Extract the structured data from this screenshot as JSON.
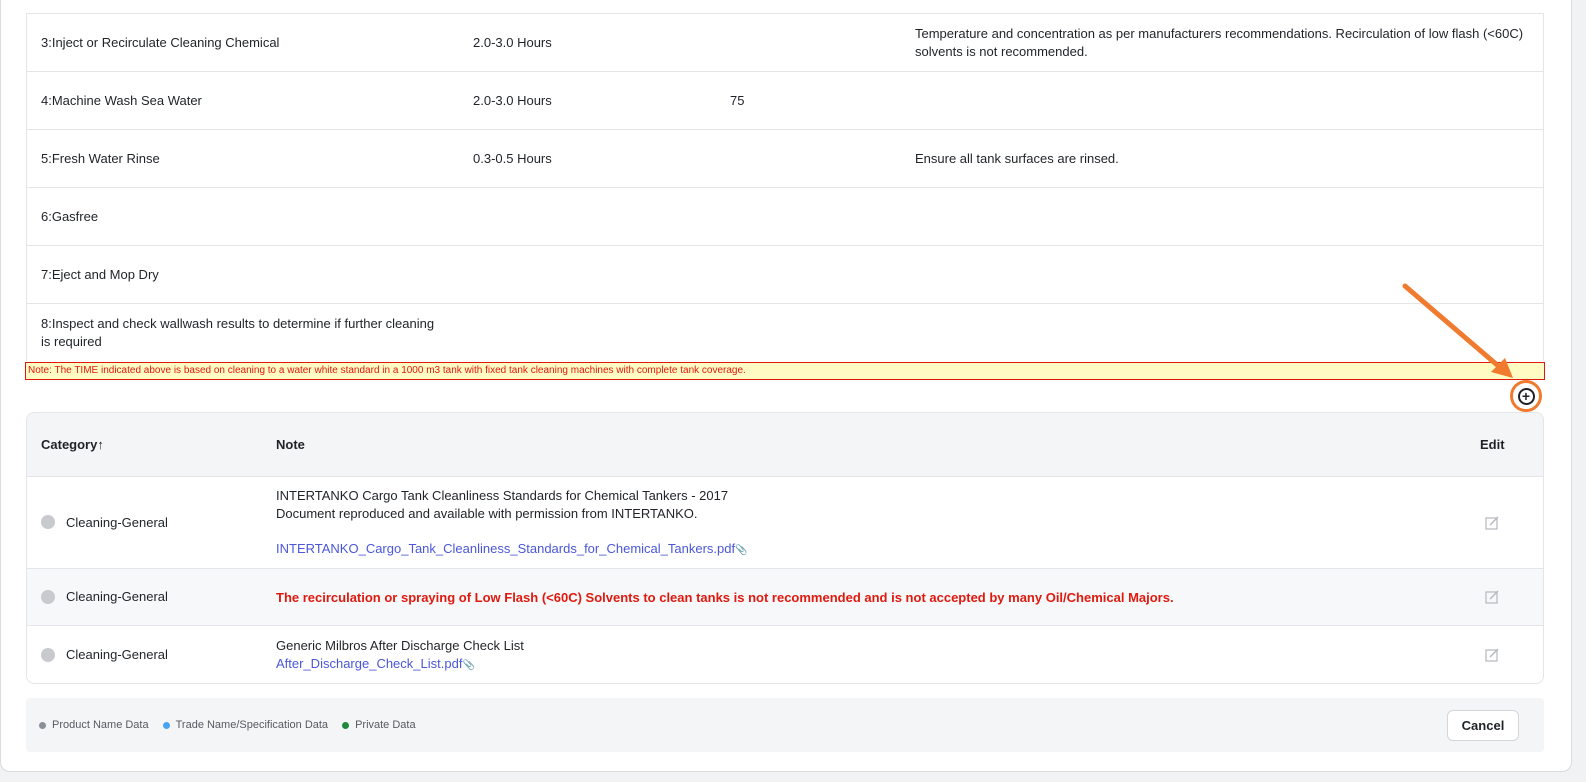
{
  "steps": [
    {
      "name": "3:Inject or Recirculate Cleaning Chemical",
      "time": "2.0-3.0 Hours",
      "temp": "",
      "remarks": "Temperature and concentration as per manufacturers recommendations. Recirculation of low flash (<60C) solvents is not recommended."
    },
    {
      "name": "4:Machine Wash Sea Water",
      "time": "2.0-3.0 Hours",
      "temp": "75",
      "remarks": ""
    },
    {
      "name": "5:Fresh Water Rinse",
      "time": "0.3-0.5 Hours",
      "temp": "",
      "remarks": "Ensure all tank surfaces are rinsed."
    },
    {
      "name": "6:Gasfree",
      "time": "",
      "temp": "",
      "remarks": ""
    },
    {
      "name": "7:Eject and Mop Dry",
      "time": "",
      "temp": "",
      "remarks": ""
    },
    {
      "name": "8:Inspect and check wallwash results to determine if further cleaning is required",
      "time": "",
      "temp": "",
      "remarks": ""
    }
  ],
  "time_note": "Note: The TIME indicated above is based on cleaning to a water white standard in a 1000 m3 tank with fixed tank cleaning machines with complete tank coverage.",
  "add_icon": "plus-circle-icon",
  "notes_table": {
    "headers": {
      "category": "Category↑",
      "note": "Note",
      "edit": "Edit"
    },
    "rows": [
      {
        "category": "Cleaning-General",
        "line1": "INTERTANKO Cargo Tank Cleanliness Standards for Chemical Tankers - 2017",
        "line2": "Document reproduced and available with permission from INTERTANKO.",
        "link": "INTERTANKO_Cargo_Tank_Cleanliness_Standards_for_Chemical_Tankers.pdf"
      },
      {
        "category": "Cleaning-General",
        "warning": "The recirculation or spraying of Low Flash (<60C) Solvents to clean tanks is not recommended and is not accepted by many Oil/Chemical Majors."
      },
      {
        "category": "Cleaning-General",
        "line1": "Generic Milbros After Discharge Check List",
        "link": "After_Discharge_Check_List.pdf"
      }
    ]
  },
  "legend": [
    {
      "label": "Product Name Data",
      "color": "#8a9099"
    },
    {
      "label": "Trade Name/Specification Data",
      "color": "#4aa3f0"
    },
    {
      "label": "Private Data",
      "color": "#1e8a3c"
    }
  ],
  "cancel_label": "Cancel",
  "colors": {
    "note_red": "#e0190f",
    "highlight_orange": "#f07a2d",
    "link_blue": "#4a57d9"
  }
}
